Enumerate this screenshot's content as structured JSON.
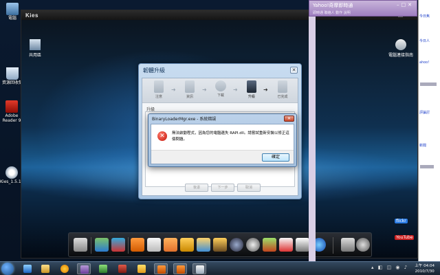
{
  "desktop": {
    "icons": [
      {
        "label": "電腦"
      },
      {
        "label": "資源回收筒"
      },
      {
        "label": "Adobe Reader 9"
      },
      {
        "label": "Kies_1.5.1...."
      }
    ]
  },
  "kies": {
    "title": "Kies",
    "window_icons": [
      {
        "label": "共用區"
      },
      {
        "label": "電腦連接指南"
      }
    ]
  },
  "firmware_dialog": {
    "title": "韌體升級",
    "steps": [
      {
        "label": "注意"
      },
      {
        "label": "資訊"
      },
      {
        "label": "下載"
      },
      {
        "label": "升級"
      },
      {
        "label": "已完成"
      }
    ],
    "current_step": 4,
    "section_label": "升級",
    "buttons": {
      "back": "後退",
      "next": "下一步",
      "cancel": "取消"
    }
  },
  "error_dialog": {
    "title": "BinaryLoaderMgr.exe - 系統錯誤",
    "message": "無法啟動程式，因為您的電腦遺失 RAPI.dll。請嘗試重新安裝以修正這個問題。",
    "ok_label": "確定"
  },
  "messenger": {
    "title": "Yahoo!奇摩即時通",
    "menu": "即時通 聯絡人 動作 說明"
  },
  "web_links": [
    "今日焦",
    "今日人",
    "ahoo!",
    "評論討",
    "新聞"
  ],
  "web_badges": [
    "flickr",
    "YouTube"
  ],
  "taskbar": {
    "clock_time": "上午 04:04",
    "clock_date": "2010/7/30"
  },
  "colors": {
    "kies_glow": "#1b5f95",
    "error_icon": "#c4140a",
    "messenger_header": "#9f7fbf"
  }
}
